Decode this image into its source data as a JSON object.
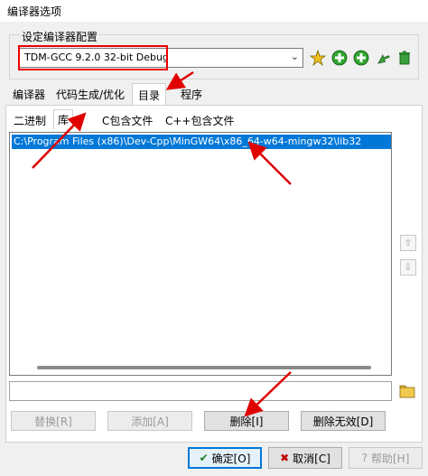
{
  "window": {
    "title": "编译器选项"
  },
  "compiler_set": {
    "group_label": "设定编译器配置",
    "selected": "TDM-GCC 9.2.0 32-bit Debug",
    "icons": [
      "magic-wand-icon",
      "add-icon",
      "add-icon",
      "rename-icon",
      "delete-icon"
    ]
  },
  "tabs": [
    "编译器",
    "代码生成/优化",
    "目录",
    "程序"
  ],
  "subtabs": [
    "二进制",
    "库",
    "C包含文件",
    "C++包含文件"
  ],
  "list": {
    "items": [
      "C:\\Program Files (x86)\\Dev-Cpp\\MinGW64\\x86_64-w64-mingw32\\lib32"
    ]
  },
  "edit_value": "",
  "actions": {
    "replace": "替换[R]",
    "add": "添加[A]",
    "delete": "删除[I]",
    "delete_invalid": "删除无效[D]"
  },
  "dialog_buttons": {
    "ok": "确定[O]",
    "cancel": "取消[C]",
    "help": "帮助[H]"
  },
  "colors": {
    "selection": "#0078d7",
    "annotation": "#e00000",
    "ok_check": "#1a7f1a",
    "cancel_x": "#c00000"
  }
}
